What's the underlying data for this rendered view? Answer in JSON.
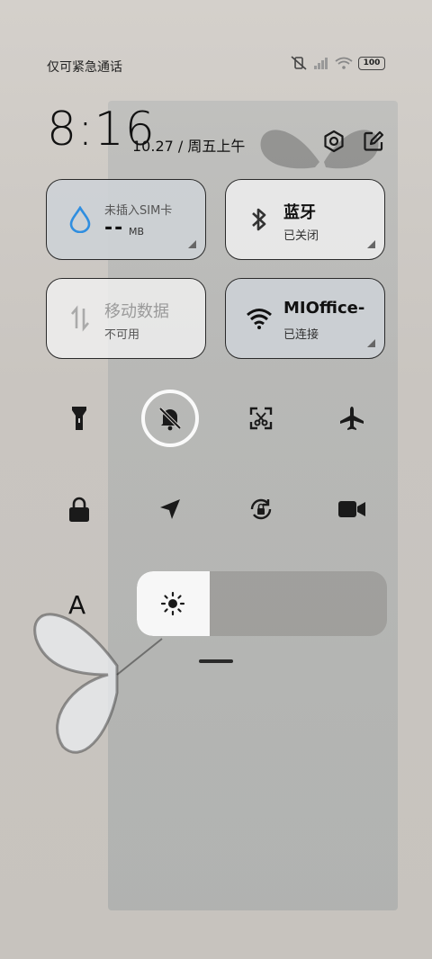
{
  "status_bar": {
    "carrier": "仅可紧急通话",
    "battery": "100"
  },
  "header": {
    "time": "8:16",
    "date": "10.27 / 周五上午"
  },
  "tiles": {
    "data_usage": {
      "title": "未插入SIM卡",
      "value": "--",
      "unit": "MB"
    },
    "bluetooth": {
      "title": "蓝牙",
      "status": "已关闭"
    },
    "mobile_data": {
      "title": "移动数据",
      "status": "不可用"
    },
    "wifi": {
      "title": "MIOffice-",
      "status": "已连接"
    }
  },
  "toggles": [
    {
      "name": "flashlight",
      "icon": "flashlight-icon",
      "active": false
    },
    {
      "name": "mute",
      "icon": "bell-off-icon",
      "active": true
    },
    {
      "name": "screenshot",
      "icon": "screenshot-icon",
      "active": false
    },
    {
      "name": "airplane",
      "icon": "airplane-icon",
      "active": false
    },
    {
      "name": "lock",
      "icon": "lock-icon",
      "active": false
    },
    {
      "name": "location",
      "icon": "location-icon",
      "active": false
    },
    {
      "name": "auto-rotate",
      "icon": "rotate-lock-icon",
      "active": false
    },
    {
      "name": "screen-record",
      "icon": "video-icon",
      "active": false
    }
  ],
  "brightness": {
    "font_label": "A",
    "level": 0.29
  }
}
